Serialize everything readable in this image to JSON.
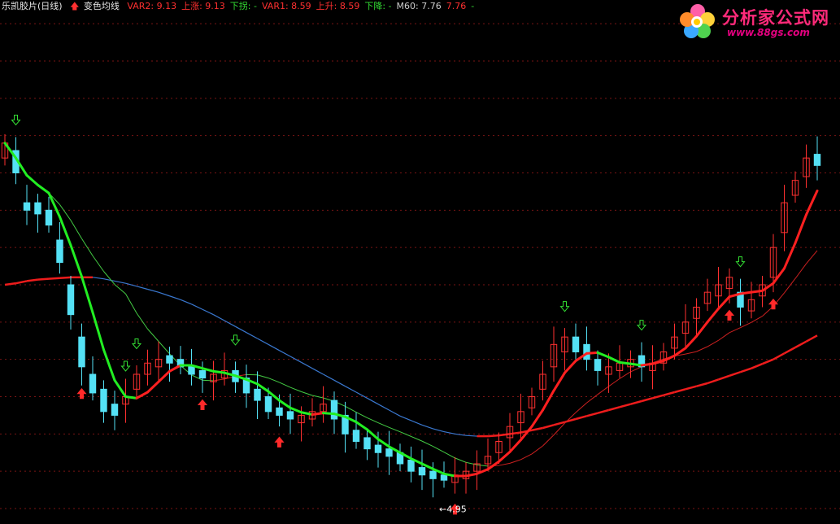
{
  "header": {
    "stock_name": "乐凯胶片(日线)",
    "indicator_name": "变色均线",
    "fields": [
      {
        "label": "VAR2",
        "value": "9.13",
        "color": "#ff3030"
      },
      {
        "label": "上涨",
        "value": "9.13",
        "color": "#ff3030"
      },
      {
        "label": "下拐",
        "value": "-",
        "color": "#33dd33"
      },
      {
        "label": "VAR1",
        "value": "8.59",
        "color": "#ff3030"
      },
      {
        "label": "上升",
        "value": "8.59",
        "color": "#ff3030"
      },
      {
        "label": "下降",
        "value": "-",
        "color": "#33dd33"
      },
      {
        "label": "M60",
        "value": "7.76",
        "color": "#cccccc"
      },
      {
        "label": "",
        "value": "7.76",
        "color": "#ff3030"
      },
      {
        "label": "",
        "value": "-",
        "color": "#33dd33"
      }
    ]
  },
  "logo": {
    "title": "分析家公式网",
    "url": "www.88gs.com"
  },
  "colors": {
    "up": "#ff3030",
    "down": "#54e1f5",
    "rising": "#ff2020",
    "falling": "#22ee22",
    "m60_rise": "#ee1c1c",
    "m60_fall": "#3a78d0",
    "grid": "#7a1414",
    "buy_arrow": "#ff2a2a",
    "sell_arrow": "#33dd33"
  },
  "chart_data": {
    "type": "candlestick",
    "title": "乐凯胶片(日线)",
    "ylim": [
      4.5,
      11.1
    ],
    "grid": "horizontal dotted",
    "low_label": "4.95",
    "closes": [
      9.4,
      9.0,
      8.5,
      8.45,
      8.3,
      7.8,
      7.1,
      6.4,
      6.05,
      5.8,
      5.75,
      6.0,
      6.3,
      6.45,
      6.5,
      6.45,
      6.4,
      6.3,
      6.25,
      6.3,
      6.35,
      6.2,
      6.05,
      5.95,
      5.8,
      5.75,
      5.7,
      5.75,
      5.8,
      5.9,
      5.7,
      5.5,
      5.4,
      5.3,
      5.25,
      5.2,
      5.1,
      5.0,
      4.95,
      4.9,
      4.88,
      4.95,
      5.0,
      5.1,
      5.2,
      5.4,
      5.6,
      5.8,
      6.0,
      6.3,
      6.7,
      6.8,
      6.6,
      6.5,
      6.35,
      6.4,
      6.45,
      6.5,
      6.4,
      6.45,
      6.6,
      6.8,
      7.0,
      7.2,
      7.4,
      7.5,
      7.6,
      7.2,
      7.3,
      7.5,
      8.0,
      8.6,
      8.9,
      9.2,
      9.1
    ],
    "opens": [
      9.2,
      9.3,
      8.6,
      8.6,
      8.5,
      8.1,
      7.5,
      6.8,
      6.3,
      6.1,
      5.9,
      5.9,
      6.1,
      6.3,
      6.4,
      6.55,
      6.5,
      6.4,
      6.35,
      6.2,
      6.25,
      6.35,
      6.25,
      6.1,
      6.0,
      5.85,
      5.8,
      5.65,
      5.7,
      5.8,
      5.95,
      5.75,
      5.55,
      5.45,
      5.35,
      5.3,
      5.25,
      5.15,
      5.05,
      5.0,
      4.95,
      4.85,
      4.9,
      5.0,
      5.1,
      5.25,
      5.45,
      5.65,
      5.85,
      6.1,
      6.4,
      6.6,
      6.8,
      6.7,
      6.5,
      6.3,
      6.35,
      6.4,
      6.55,
      6.35,
      6.45,
      6.65,
      6.85,
      7.05,
      7.25,
      7.35,
      7.45,
      7.4,
      7.15,
      7.35,
      7.6,
      8.2,
      8.7,
      8.95,
      9.25
    ],
    "m60": [
      7.5,
      7.52,
      7.55,
      7.57,
      7.58,
      7.59,
      7.6,
      7.6,
      7.6,
      7.58,
      7.55,
      7.52,
      7.48,
      7.44,
      7.4,
      7.35,
      7.3,
      7.24,
      7.17,
      7.1,
      7.02,
      6.94,
      6.86,
      6.78,
      6.7,
      6.62,
      6.54,
      6.46,
      6.38,
      6.3,
      6.22,
      6.14,
      6.06,
      5.98,
      5.9,
      5.82,
      5.74,
      5.68,
      5.62,
      5.57,
      5.53,
      5.5,
      5.48,
      5.47,
      5.47,
      5.48,
      5.5,
      5.52,
      5.55,
      5.58,
      5.62,
      5.66,
      5.7,
      5.74,
      5.78,
      5.82,
      5.86,
      5.9,
      5.94,
      5.98,
      6.02,
      6.06,
      6.1,
      6.14,
      6.18,
      6.23,
      6.28,
      6.33,
      6.38,
      6.44,
      6.5,
      6.58,
      6.66,
      6.74,
      6.82
    ],
    "buy_signals": [
      7,
      18,
      25,
      41,
      66,
      70
    ],
    "sell_signals": [
      1,
      11,
      12,
      21,
      51,
      58,
      67
    ]
  }
}
